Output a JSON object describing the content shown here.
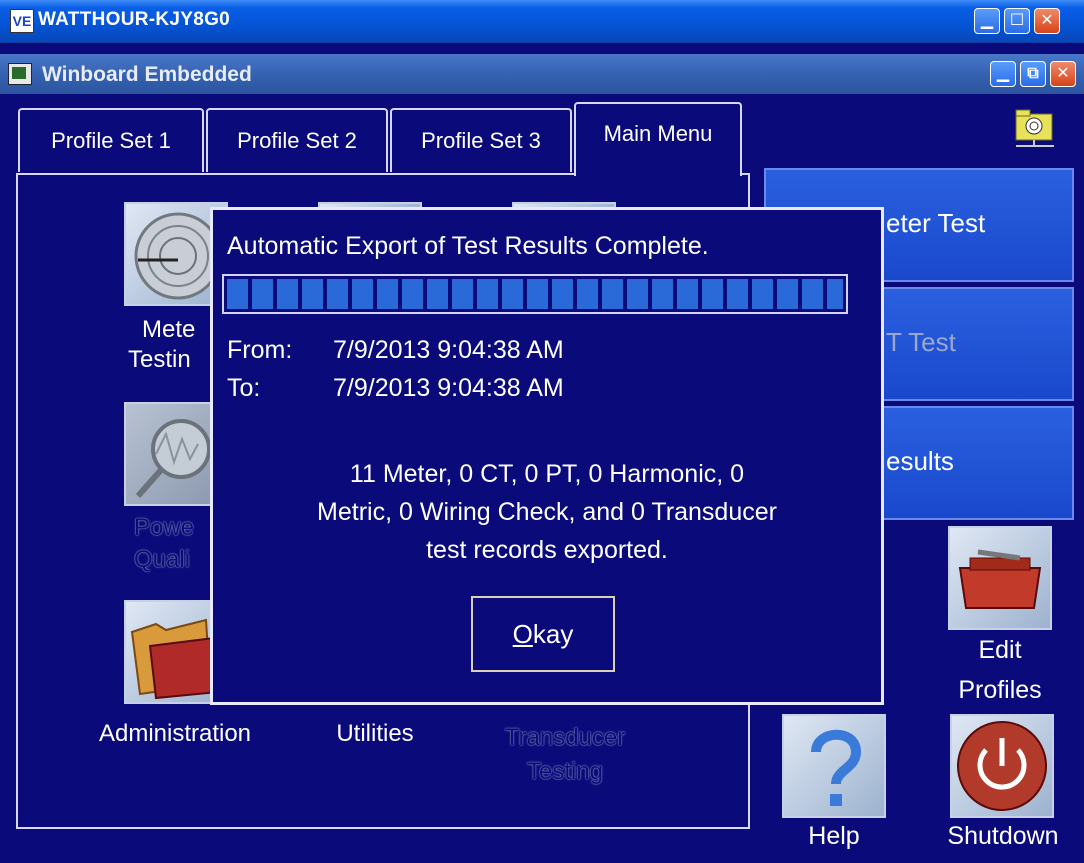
{
  "outer_window": {
    "icon_text": "VE",
    "title": "WATTHOUR-KJY8G0"
  },
  "inner_window": {
    "title": "Winboard Embedded"
  },
  "tabs": [
    {
      "label": "Profile Set 1"
    },
    {
      "label": "Profile Set 2"
    },
    {
      "label": "Profile Set 3"
    },
    {
      "label": "Main Menu",
      "active": true
    }
  ],
  "tiles": {
    "meter_testing": "Meter Testing",
    "meter_testing_line1": "Mete",
    "meter_testing_line2": "Testin",
    "power_quality_line1": "Powe",
    "power_quality_line2": "Quali",
    "administration": "Administration",
    "utilities": "Utilities",
    "transducer_line1": "Transducer",
    "transducer_line2": "Testing"
  },
  "right_buttons": [
    {
      "label": "eter Test"
    },
    {
      "label": "T Test"
    },
    {
      "label": "esults"
    }
  ],
  "bottom_buttons": {
    "edit_profiles_line1": "Edit",
    "edit_profiles_line2": "Profiles",
    "help": "Help",
    "shutdown": "Shutdown"
  },
  "dialog": {
    "title": "Automatic Export of Test Results Complete.",
    "progress": 1.0,
    "from_label": "From:",
    "from_value": "7/9/2013 9:04:38 AM",
    "to_label": "To:",
    "to_value": "7/9/2013 9:04:38 AM",
    "message_line1": "11 Meter, 0 CT, 0 PT, 0 Harmonic, 0",
    "message_line2": "Metric, 0 Wiring Check, and 0 Transducer",
    "message_line3": "test records exported.",
    "okay_label_mnemonic": "O",
    "okay_label_rest": "kay"
  },
  "colors": {
    "background": "#0a0a7a",
    "button_blue": "#1a48cc",
    "title_blue": "#0554d6"
  }
}
